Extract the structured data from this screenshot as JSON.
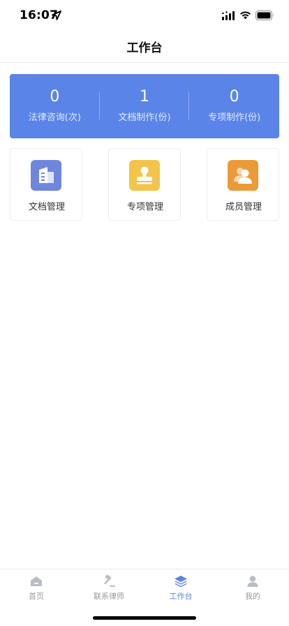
{
  "status_bar": {
    "time": "16:07",
    "icons": [
      "location-arrow-icon",
      "signal-icon",
      "wifi-icon",
      "battery-icon"
    ]
  },
  "nav": {
    "title": "工作台"
  },
  "stats": [
    {
      "value": "0",
      "label": "法律咨询(次)"
    },
    {
      "value": "1",
      "label": "文档制作(份)"
    },
    {
      "value": "0",
      "label": "专项制作(份)"
    }
  ],
  "tiles": [
    {
      "label": "文档管理",
      "icon": "document-building-icon",
      "color": "#6f86de"
    },
    {
      "label": "专项管理",
      "icon": "stamp-icon",
      "color": "#f2c449"
    },
    {
      "label": "成员管理",
      "icon": "members-icon",
      "color": "#ec9a38"
    }
  ],
  "tabbar": {
    "items": [
      {
        "label": "首页",
        "icon": "home-icon",
        "active": false
      },
      {
        "label": "联系律师",
        "icon": "gavel-icon",
        "active": false
      },
      {
        "label": "工作台",
        "icon": "layers-icon",
        "active": true
      },
      {
        "label": "我的",
        "icon": "user-icon",
        "active": false
      }
    ]
  },
  "colors": {
    "accent": "#5a84e8",
    "stats_bg": "#5a84e8",
    "tab_inactive": "#9a9a9a"
  }
}
